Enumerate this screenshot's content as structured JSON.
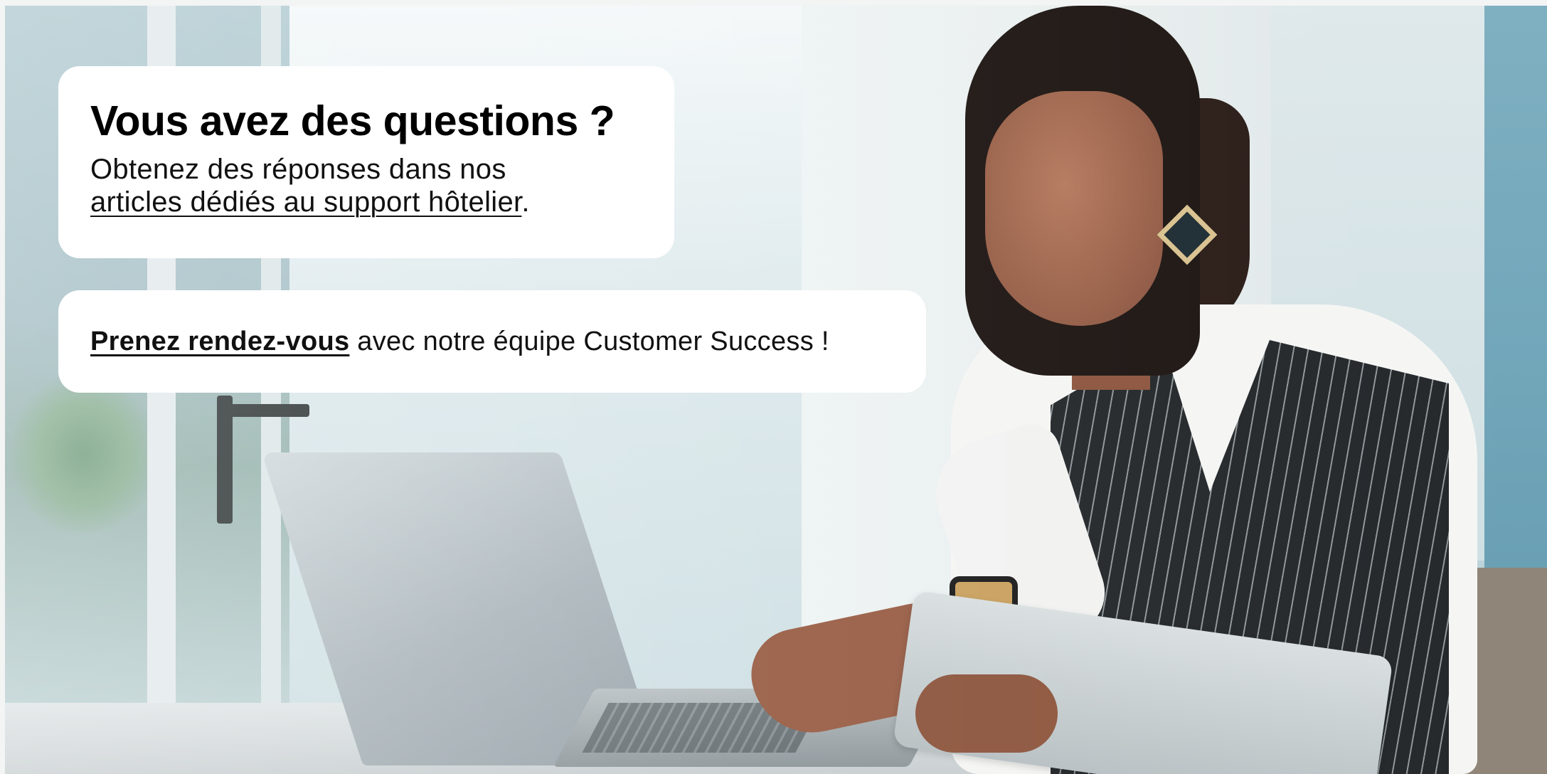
{
  "support_card": {
    "title": "Vous avez des questions ?",
    "intro": "Obtenez des réponses dans nos ",
    "link_label": "articles dédiés au support hôtelier",
    "trailing": "."
  },
  "appointment_card": {
    "link_label": "Prenez rendez-vous",
    "text": " avec notre équipe Customer Success !"
  },
  "photo": {
    "icon": "office-worker-laptop-photo"
  }
}
